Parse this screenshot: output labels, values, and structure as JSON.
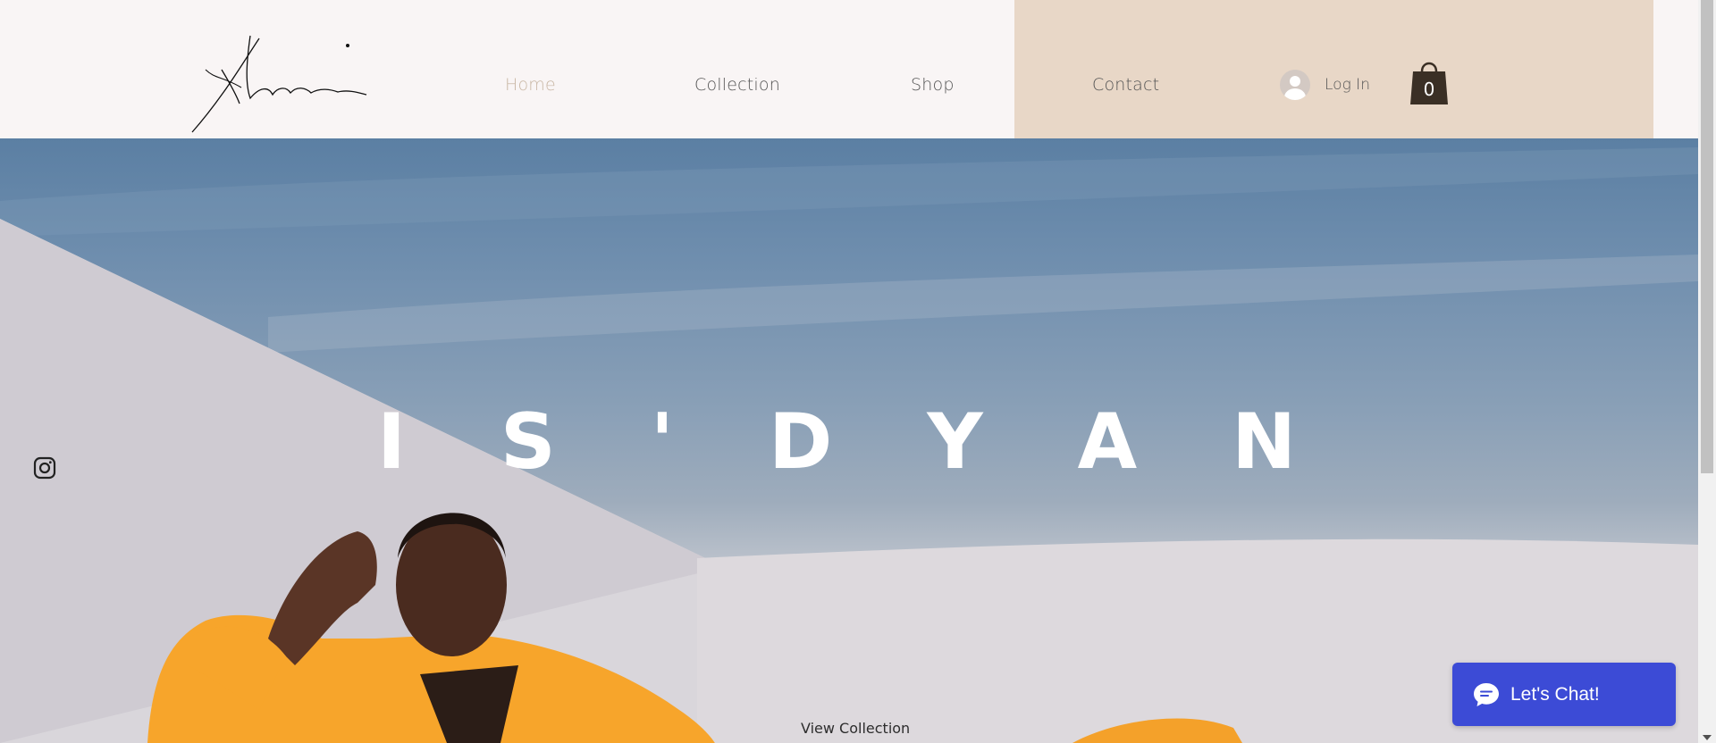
{
  "header": {
    "logo_icon": "signature-logo",
    "nav": [
      {
        "label": "Home",
        "active": true
      },
      {
        "label": "Collection",
        "active": false
      },
      {
        "label": "Shop",
        "active": false
      },
      {
        "label": "Contact",
        "active": false
      }
    ],
    "login_label": "Log In",
    "cart_count": "0",
    "accent_color": "#e8d7c7",
    "active_nav_color": "#c9b7a5"
  },
  "hero": {
    "title": "I S ' D Y A N",
    "cta_label": "View Collection",
    "outfit_color": "#f7a52b"
  },
  "social": {
    "icon": "instagram-icon"
  },
  "chat": {
    "label": "Let's Chat!",
    "color": "#3c4bd6"
  }
}
